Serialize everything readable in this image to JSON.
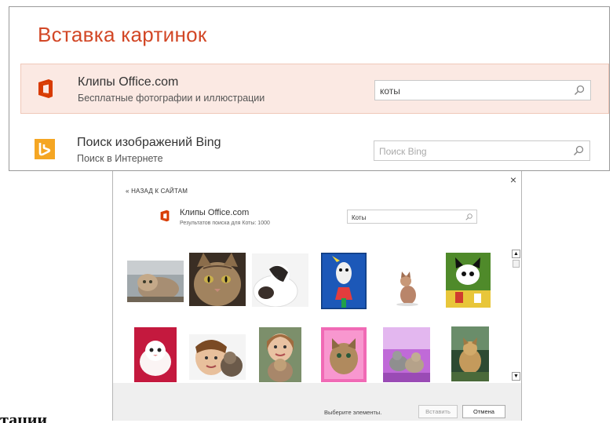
{
  "insert_dialog": {
    "title": "Вставка картинок",
    "sources": [
      {
        "name": "Клипы Office.com",
        "desc": "Бесплатные фотографии и иллюстрации",
        "search_value": "коты",
        "search_placeholder": "",
        "icon": "office-icon",
        "accent": "#d83b01"
      },
      {
        "name": "Поиск изображений Bing",
        "desc": "Поиск в Интернете",
        "search_value": "",
        "search_placeholder": "Поиск Bing",
        "icon": "bing-icon",
        "accent": "#f5a623"
      }
    ]
  },
  "results_dialog": {
    "close": "×",
    "back": "« НАЗАД К САЙТАМ",
    "source_name": "Клипы Office.com",
    "result_count": "Результатов поиска для Коты: 1000",
    "search_value": "Коты",
    "hint": "Выберите элементы.",
    "insert_label": "Вставить",
    "cancel_label": "Отмена",
    "thumbnails": [
      {
        "icon": "cat-photo-icon"
      },
      {
        "icon": "cat-photo-icon"
      },
      {
        "icon": "cat-photo-icon"
      },
      {
        "icon": "cat-clipart-icon"
      },
      {
        "icon": "cat-clipart-icon"
      },
      {
        "icon": "cat-clipart-icon"
      },
      {
        "icon": "cat-photo-icon"
      },
      {
        "icon": "cat-photo-icon"
      },
      {
        "icon": "cat-photo-icon"
      },
      {
        "icon": "cat-photo-icon"
      },
      {
        "icon": "cat-photo-icon"
      },
      {
        "icon": "cat-photo-icon"
      }
    ]
  },
  "background_text": "тации",
  "colors": {
    "title_accent": "#d24726",
    "selected_row": "#fbe9e3"
  }
}
